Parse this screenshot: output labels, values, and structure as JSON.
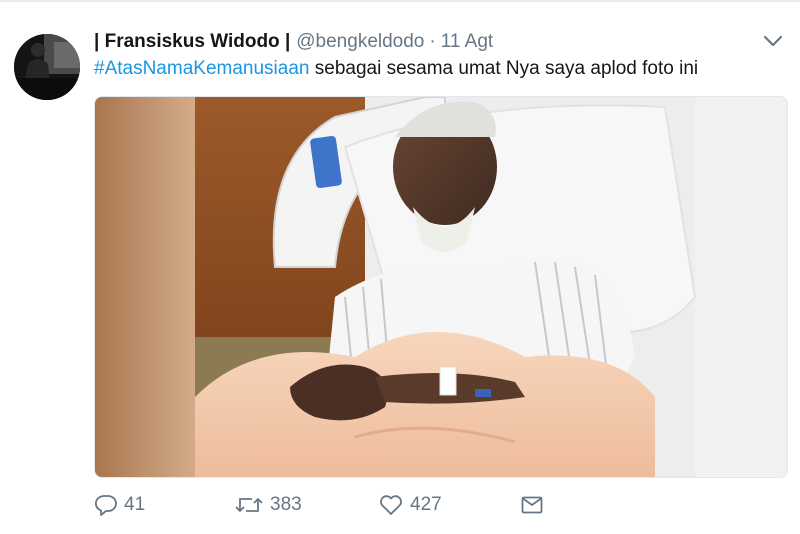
{
  "tweet": {
    "display_name": "| Fransiskus Widodo |",
    "handle": "@bengkeldodo",
    "separator": "·",
    "date": "11 Agt",
    "hashtag": "#AtasNamaKemanusiaan",
    "body_text": " sebagai sesama umat Nya saya aplod foto ini"
  },
  "actions": {
    "reply_count": "41",
    "retweet_count": "383",
    "like_count": "427"
  },
  "icons": [
    "profile-avatar",
    "chevron-down-icon",
    "reply-icon",
    "retweet-icon",
    "heart-icon",
    "message-icon"
  ],
  "colors": {
    "link": "#1b95e0",
    "muted": "#657786",
    "text": "#14171a"
  }
}
